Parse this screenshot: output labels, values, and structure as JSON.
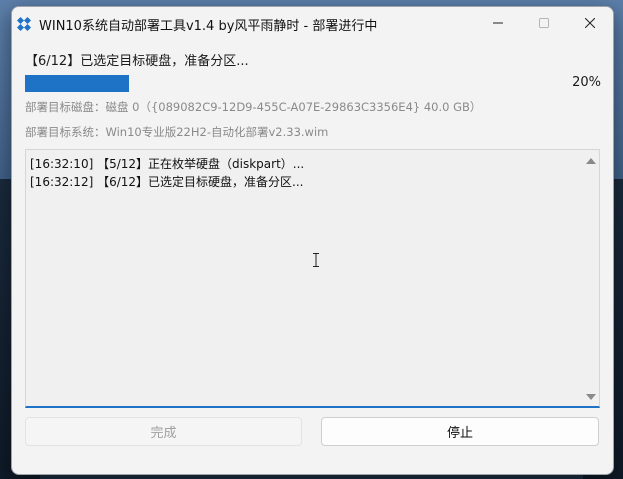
{
  "window": {
    "title": "WIN10系统自动部署工具v1.4 by风平雨静时 - 部署进行中",
    "icon": "blue-diamond-grid-icon"
  },
  "controls": {
    "minimize_icon": "minimize-icon",
    "maximize_icon": "maximize-icon",
    "close_icon": "close-icon"
  },
  "status": {
    "step_text": "【6/12】已选定目标硬盘，准备分区...",
    "progress_percent": 20,
    "progress_label": "20%"
  },
  "info": {
    "target_disk": "部署目标磁盘：磁盘 0（{089082C9-12D9-455C-A07E-29863C3356E4} 40.0 GB）",
    "target_system": "部署目标系统：Win10专业版22H2-自动化部署v2.33.wim"
  },
  "log": {
    "lines": [
      "[16:32:10] 【5/12】正在枚举硬盘（diskpart）...",
      "[16:32:12] 【6/12】已选定目标硬盘，准备分区..."
    ]
  },
  "buttons": {
    "done_label": "完成",
    "stop_label": "停止"
  },
  "colors": {
    "accent": "#1f73c7",
    "window_bg": "#f3f3f3",
    "disabled_text": "#a0a0a0"
  }
}
